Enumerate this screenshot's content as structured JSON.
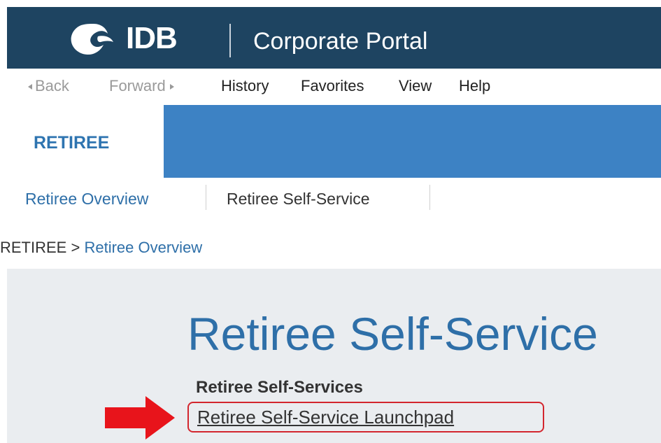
{
  "header": {
    "logo_text": "IDB",
    "portal_title": "Corporate Portal",
    "colors": {
      "background": "#1e4461"
    }
  },
  "menubar": {
    "back": "Back",
    "forward": "Forward",
    "items": [
      "History",
      "Favorites",
      "View",
      "Help"
    ]
  },
  "tabs": {
    "active": "RETIREE",
    "colors": {
      "active_text": "#2e74b0",
      "fill": "#3d82c4"
    }
  },
  "subtabs": [
    "Retiree Overview",
    "Retiree Self-Service"
  ],
  "breadcrumb": {
    "root": "RETIREE",
    "separator": ">",
    "current": "Retiree Overview"
  },
  "main": {
    "title": "Retiree Self-Service",
    "section_heading": "Retiree Self-Services",
    "link": "Retiree Self-Service Launchpad"
  },
  "annotation": {
    "highlight_color": "#d3262e",
    "arrow_color": "#e8141b"
  },
  "icons": [
    "idb-logo-icon",
    "back-arrow-icon",
    "forward-arrow-icon",
    "red-arrow-icon"
  ]
}
